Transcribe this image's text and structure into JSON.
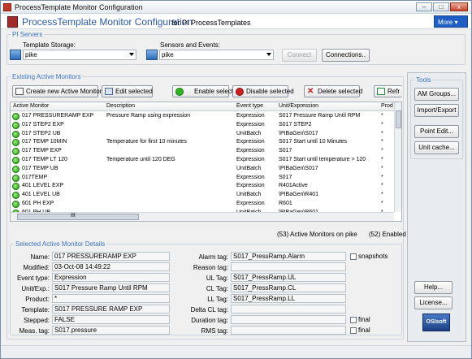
{
  "window": {
    "title": "ProcessTemplate Monitor Configuration",
    "min": "–",
    "max": "□",
    "close": "x"
  },
  "header": {
    "title": "ProcessTemplate Monitor Configuration",
    "subtitle": "for PI ProcessTemplates",
    "more": "More"
  },
  "pi_servers": {
    "legend": "PI Servers",
    "template_label": "Template Storage:",
    "template_value": "pike",
    "sensors_label": "Sensors and Events:",
    "sensors_value": "pike",
    "connect": "Connect",
    "connections": "Connections.."
  },
  "monitors": {
    "legend": "Existing Active Monitors",
    "toolbar": {
      "create": "Create new Active Monitor",
      "edit": "Edit selected",
      "enable": "Enable selected",
      "disable": "Disable selected",
      "delete": "Delete selected",
      "refresh": "Refr"
    },
    "columns": [
      "Active Monitor",
      "Description",
      "Event type",
      "Unit/Expression",
      "Prod"
    ],
    "rows": [
      [
        "017 PRESSURERAMP EXP",
        "Pressure Ramp using expression",
        "Expression",
        "S017 Pressure Ramp Until RPM",
        "*"
      ],
      [
        "017 STEP2 EXP",
        "",
        "Expression",
        "S017 STEP2",
        "*"
      ],
      [
        "017 STEP2 UB",
        "",
        "UnitBatch",
        "\\PIBaGen\\S017",
        "*"
      ],
      [
        "017 TEMP 10MIN",
        "Temperature for first 10 minutes",
        "Expression",
        "S017 Start until 10 Minutes",
        "*"
      ],
      [
        "017 TEMP EXP",
        "",
        "Expression",
        "S017",
        "*"
      ],
      [
        "017 TEMP LT 120",
        "Temperature until 120 DEG",
        "Expression",
        "S017 Start until temperature > 120",
        "*"
      ],
      [
        "017 TEMP UB",
        "",
        "UnitBatch",
        "\\PIBaGen\\S017",
        "*"
      ],
      [
        "017TEMP",
        "",
        "Expression",
        "S017",
        "*"
      ],
      [
        "401 LEVEL EXP",
        "",
        "Expression",
        "R401Active",
        "*"
      ],
      [
        "401 LEVEL UB",
        "",
        "UnitBatch",
        "\\PIBaGen\\R401",
        "*"
      ],
      [
        "601 PH EXP",
        "",
        "Expression",
        "R601",
        "*"
      ],
      [
        "601 PH UB",
        "",
        "UnitBatch",
        "\\PIBaGen\\R601",
        "*"
      ],
      [
        "601 XY EXP",
        "",
        "Expression",
        "R601",
        "*"
      ]
    ],
    "hscroll_label": "III",
    "status_count": "(53) Active Monitors on pike",
    "status_enabled": "(52) Enabled"
  },
  "details": {
    "legend": "Selected Active Monitor Details",
    "name_label": "Name:",
    "name": "017 PRESSURERAMP EXP",
    "modified_label": "Modified:",
    "modified": "03-Oct-08 14:49:22",
    "event_type_label": "Event type:",
    "event_type": "Expression",
    "unit_exp_label": "Unit/Exp.:",
    "unit_exp": "S017 Pressure Ramp Until RPM",
    "product_label": "Product:",
    "product": "*",
    "template_label": "Template:",
    "template": "S017 PRESSURE RAMP EXP",
    "stepped_label": "Stepped:",
    "stepped": "FALSE",
    "meas_label": "Meas. tag:",
    "meas": "S017.pressure",
    "alarm_label": "Alarm tag:",
    "alarm": "S017_PressRamp.Alarm",
    "reason_label": "Reason tag:",
    "reason": "",
    "ul_label": "UL Tag:",
    "ul": "S017_PressRamp.UL",
    "cl_label": "CL Tag:",
    "cl": "S017_PressRamp.CL",
    "ll_label": "LL Tag:",
    "ll": "S017_PressRamp.LL",
    "delta_label": "Delta CL tag:",
    "delta": "",
    "duration_label": "Duration tag:",
    "duration": "",
    "rms_label": "RMS tag:",
    "rms": "",
    "snapshots": "snapshots",
    "final1": "final",
    "final2": "final"
  },
  "tools": {
    "legend": "Tools",
    "am_groups": "AM Groups...",
    "import_export": "Import/Export",
    "point_edit": "Point Edit...",
    "unit_cache": "Unit cache...",
    "help": "Help...",
    "license": "License...",
    "logo": "OSIsoft"
  }
}
